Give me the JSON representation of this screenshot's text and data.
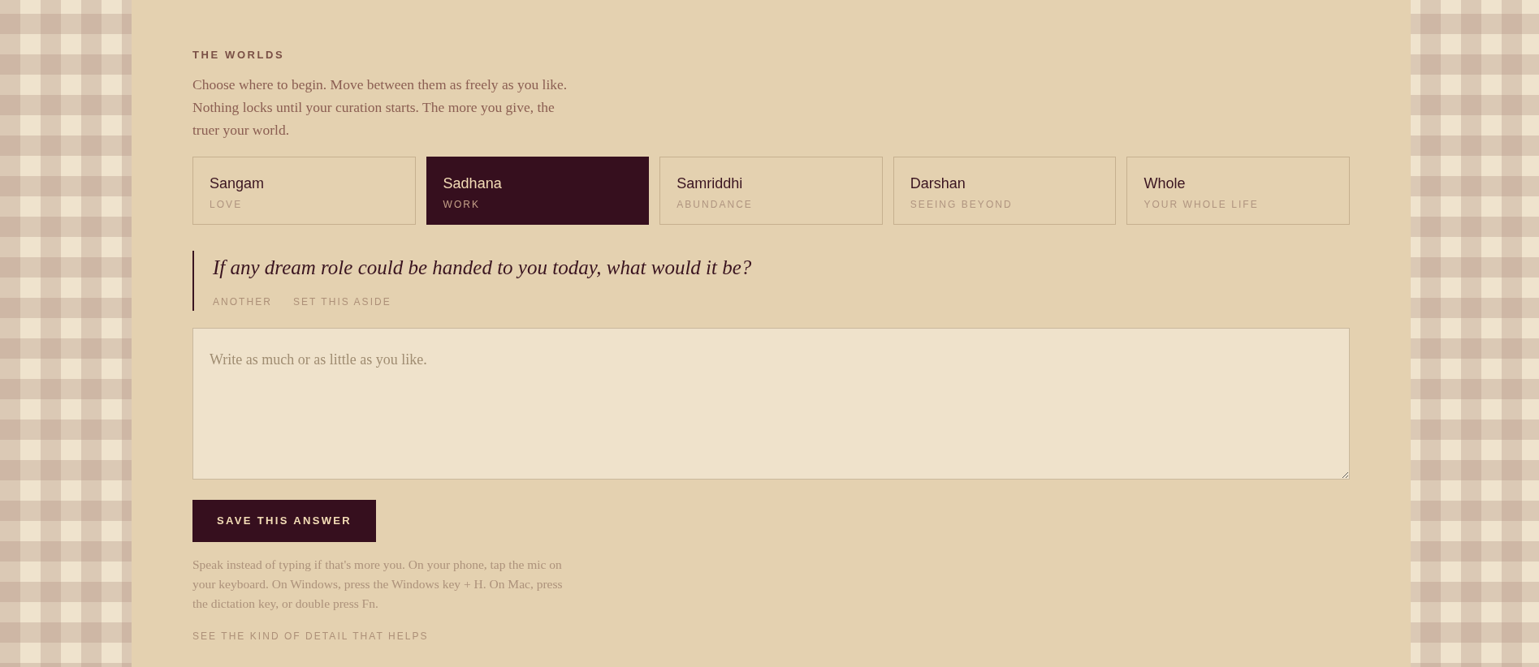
{
  "section": {
    "eyebrow": "THE WORLDS",
    "intro": "Choose where to begin. Move between them as freely as you like. Nothing locks until your curation starts. The more you give, the truer your world."
  },
  "worlds": [
    {
      "name": "Sangam",
      "subtitle": "LOVE",
      "selected": false
    },
    {
      "name": "Sadhana",
      "subtitle": "WORK",
      "selected": true
    },
    {
      "name": "Samriddhi",
      "subtitle": "ABUNDANCE",
      "selected": false
    },
    {
      "name": "Darshan",
      "subtitle": "SEEING BEYOND",
      "selected": false
    },
    {
      "name": "Whole",
      "subtitle": "YOUR WHOLE LIFE",
      "selected": false
    }
  ],
  "prompt": {
    "question": "If any dream role could be handed to you today, what would it be?",
    "actions": [
      "ANOTHER",
      "SET THIS ASIDE"
    ]
  },
  "answer": {
    "placeholder": "Write as much or as little as you like."
  },
  "save_button": "SAVE THIS ANSWER",
  "dictation_hint": "Speak instead of typing if that's more you. On your phone, tap the mic on your keyboard. On Windows, press the Windows key + H. On Mac, press the dictation key, or double press Fn.",
  "help_link": "SEE THE KIND OF DETAIL THAT HELPS"
}
